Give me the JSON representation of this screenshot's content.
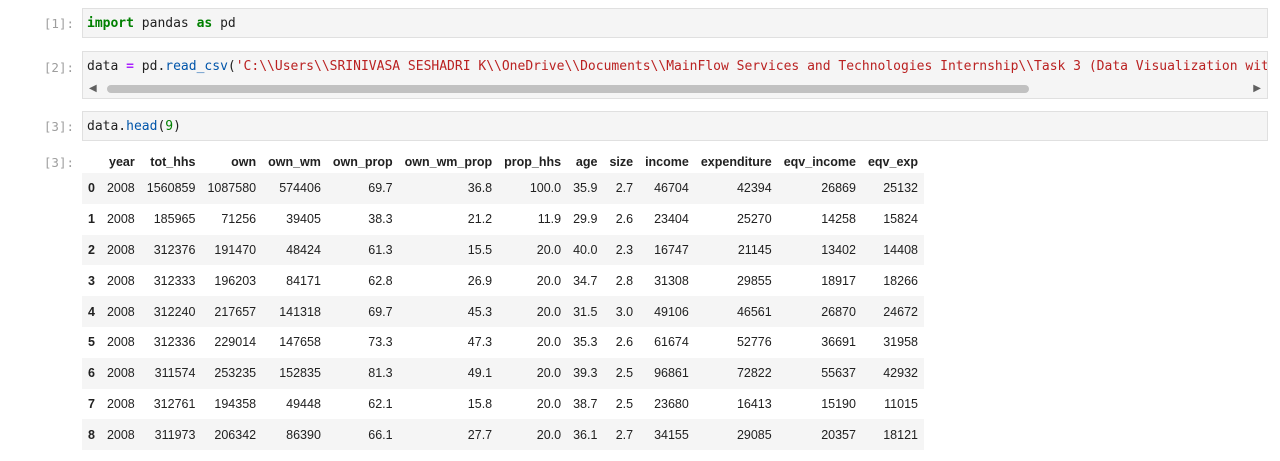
{
  "cells": [
    {
      "prompt": "[1]:",
      "code": {
        "kw1": "import",
        "mod": " pandas ",
        "kw2": "as",
        "alias": " pd"
      }
    },
    {
      "prompt": "[2]:",
      "code": {
        "var": "data ",
        "op": "=",
        "obj": " pd.",
        "fn": "read_csv",
        "paren": "(",
        "str": "'C:\\\\Users\\\\SRINIVASA SESHADRI K\\\\OneDrive\\\\Documents\\\\MainFlow Services and Technologies Internship\\\\Task 3 (Data Visualization wit"
      }
    },
    {
      "prompt": "[3]:",
      "code": {
        "obj": "data.",
        "fn": "head",
        "open": "(",
        "num": "9",
        "close": ")"
      }
    }
  ],
  "output": {
    "prompt": "[3]:",
    "columns": [
      "",
      "year",
      "tot_hhs",
      "own",
      "own_wm",
      "own_prop",
      "own_wm_prop",
      "prop_hhs",
      "age",
      "size",
      "income",
      "expenditure",
      "eqv_income",
      "eqv_exp"
    ],
    "rows": [
      [
        "0",
        "2008",
        "1560859",
        "1087580",
        "574406",
        "69.7",
        "36.8",
        "100.0",
        "35.9",
        "2.7",
        "46704",
        "42394",
        "26869",
        "25132"
      ],
      [
        "1",
        "2008",
        "185965",
        "71256",
        "39405",
        "38.3",
        "21.2",
        "11.9",
        "29.9",
        "2.6",
        "23404",
        "25270",
        "14258",
        "15824"
      ],
      [
        "2",
        "2008",
        "312376",
        "191470",
        "48424",
        "61.3",
        "15.5",
        "20.0",
        "40.0",
        "2.3",
        "16747",
        "21145",
        "13402",
        "14408"
      ],
      [
        "3",
        "2008",
        "312333",
        "196203",
        "84171",
        "62.8",
        "26.9",
        "20.0",
        "34.7",
        "2.8",
        "31308",
        "29855",
        "18917",
        "18266"
      ],
      [
        "4",
        "2008",
        "312240",
        "217657",
        "141318",
        "69.7",
        "45.3",
        "20.0",
        "31.5",
        "3.0",
        "49106",
        "46561",
        "26870",
        "24672"
      ],
      [
        "5",
        "2008",
        "312336",
        "229014",
        "147658",
        "73.3",
        "47.3",
        "20.0",
        "35.3",
        "2.6",
        "61674",
        "52776",
        "36691",
        "31958"
      ],
      [
        "6",
        "2008",
        "311574",
        "253235",
        "152835",
        "81.3",
        "49.1",
        "20.0",
        "39.3",
        "2.5",
        "96861",
        "72822",
        "55637",
        "42932"
      ],
      [
        "7",
        "2008",
        "312761",
        "194358",
        "49448",
        "62.1",
        "15.8",
        "20.0",
        "38.7",
        "2.5",
        "23680",
        "16413",
        "15190",
        "11015"
      ],
      [
        "8",
        "2008",
        "311973",
        "206342",
        "86390",
        "66.1",
        "27.7",
        "20.0",
        "36.1",
        "2.7",
        "34155",
        "29085",
        "20357",
        "18121"
      ]
    ]
  },
  "icons": {
    "scroll_left": "scroll-left-arrow",
    "scroll_right": "scroll-right-arrow"
  }
}
